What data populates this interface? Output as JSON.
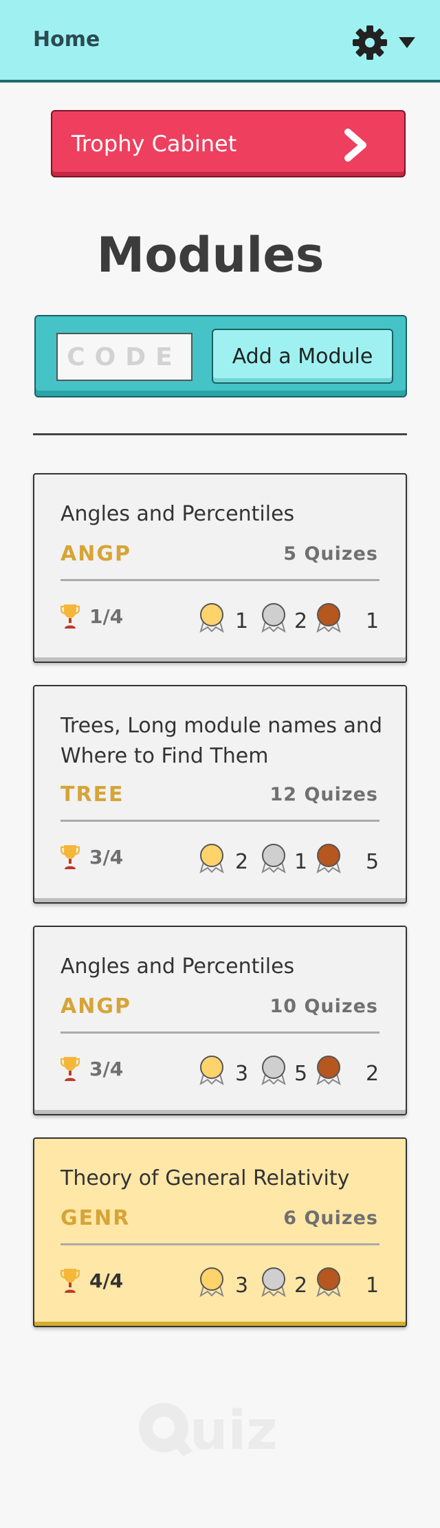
{
  "header": {
    "home_label": "Home",
    "icons": {
      "settings": "gear-icon",
      "menu": "caret-down-icon"
    }
  },
  "trophy_cabinet": {
    "label": "Trophy Cabinet",
    "icon": "chevron-right-icon"
  },
  "modules_title": "Modules",
  "add_module": {
    "code_placeholder": "CODE",
    "code_value": "",
    "button_label": "Add a Module"
  },
  "modules": [
    {
      "name": "Angles and Percentiles",
      "code": "ANGP",
      "quizzes": "5 Quizes",
      "progress": "1/4",
      "gold": "1",
      "silver": "2",
      "bronze": "1",
      "completed": false
    },
    {
      "name": "Trees, Long module names and Where to Find Them",
      "code": "TREE",
      "quizzes": "12 Quizes",
      "progress": "3/4",
      "gold": "2",
      "silver": "1",
      "bronze": "5",
      "completed": false
    },
    {
      "name": "Angles and Percentiles",
      "code": "ANGP",
      "quizzes": "10 Quizes",
      "progress": "3/4",
      "gold": "3",
      "silver": "5",
      "bronze": "2",
      "completed": false
    },
    {
      "name": "Theory of General Relativity",
      "code": "GENR",
      "quizzes": "6 Quizes",
      "progress": "4/4",
      "gold": "3",
      "silver": "2",
      "bronze": "1",
      "completed": true
    }
  ],
  "footer": {
    "logo_text": "uiz"
  },
  "colors": {
    "header_bg": "#9ff1f1",
    "trophy_button": "#ee3f5e",
    "add_box": "#45c3c6",
    "module_code": "#d6a437",
    "completed_card": "#ffe7a8",
    "medal_gold": "#ffd36b",
    "medal_silver": "#cfcfcf",
    "medal_bronze": "#b5571f"
  }
}
